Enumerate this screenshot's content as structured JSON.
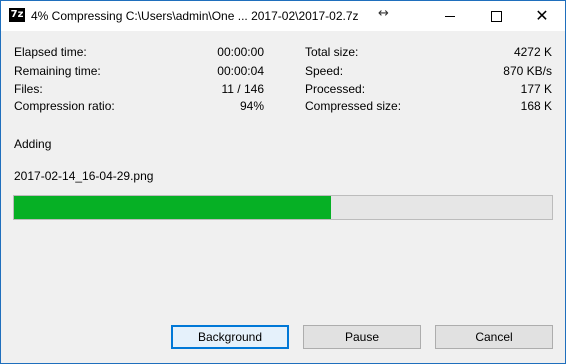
{
  "window": {
    "title": "4% Compressing C:\\Users\\admin\\One ... 2017-02\\2017-02.7z",
    "icon_text": "7z"
  },
  "stats": {
    "elapsed_label": "Elapsed time:",
    "elapsed_value": "00:00:00",
    "remaining_label": "Remaining time:",
    "remaining_value": "00:00:04",
    "files_label": "Files:",
    "files_value": "11 / 146",
    "ratio_label": "Compression ratio:",
    "ratio_value": "94%",
    "total_label": "Total size:",
    "total_value": "4272 K",
    "speed_label": "Speed:",
    "speed_value": "870 KB/s",
    "processed_label": "Processed:",
    "processed_value": "177 K",
    "compressed_label": "Compressed size:",
    "compressed_value": "168 K"
  },
  "status": {
    "action": "Adding",
    "current_file": "2017-02-14_16-04-29.png"
  },
  "progress": {
    "fraction": 0.59,
    "color": "#06b025"
  },
  "buttons": {
    "background": "Background",
    "pause": "Pause",
    "cancel": "Cancel"
  }
}
